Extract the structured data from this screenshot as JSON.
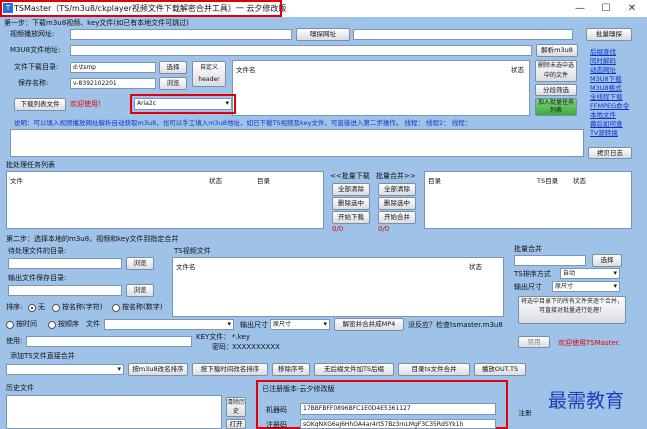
{
  "window": {
    "title": "TSMaster（TS/m3u8/ckplayer视频文件下载解密合并工具）一 云夕修改版",
    "minimize": "—",
    "maximize": "☐",
    "close": "✕"
  },
  "step1": {
    "label": "第一步：下载m3u8视频、key文件(如已有本地文件可跳过)"
  },
  "video_url": {
    "label": "视频播放网址:",
    "value": "",
    "clean_btn": "嗅探网址",
    "batch_btn": "批量嗅探"
  },
  "m3u8_url": {
    "label": "M3U8文件地址:",
    "value": "",
    "parse_btn": "解析m3u8"
  },
  "download_dir": {
    "label": "文件下载目录:",
    "value": "d:\\tsmp",
    "select_btn": "选择",
    "custom_btn": "自定义header"
  },
  "save_name": {
    "label": "保存名称:",
    "value": "v-8392102201",
    "browse_btn": "浏览"
  },
  "file_list": {
    "col_name": "文件名",
    "col_status": "状态"
  },
  "side_buttons": {
    "delete_unselected": "删除未选中选中的文件",
    "segment_filter": "分段筛选",
    "add_to_queue": "加入批量任务列表"
  },
  "download_row": {
    "btn": "下载列表文件",
    "welcome": "欢迎使用！",
    "engine": "Aria2c"
  },
  "links": [
    "后缀查找",
    "同时解码",
    "动态网址",
    "M3U8下载",
    "M3U8格式",
    "全线程下载",
    "FFMPEG命令",
    "本地文件",
    "幕后如何查",
    "TV源转换"
  ],
  "note": {
    "text": "说明：可以填入视频播放网址解析自动获取m3u8，也可以手工填入m3u8地址，如已下载TS视频及key文件，可直接进入第二步操作。 线程：  线程2：  线程："
  },
  "view_log": "拷贝日志",
  "batch": {
    "title": "批处理任务列表",
    "col_file": "文件",
    "col_status": "状态",
    "col_dir": "目录",
    "download_label": "<<批量下载",
    "start_all": "全部清除",
    "delete_selected": "删除选中",
    "start_download": "开始下载",
    "count1": "0/0",
    "merge_label": "批量合并>>",
    "merge_all": "全部清除",
    "merge_delete": "删除选中",
    "start_merge": "开始合并",
    "count2": "0/0",
    "col_dir2": "目录",
    "col_ts": "TS目录",
    "col_status2": "状态"
  },
  "step2": {
    "label": "第二步：选择本地的m3u8，视频和key文件到指定合并"
  },
  "pending": {
    "label": "待处理文件的目录:",
    "value": "",
    "browse_btn": "浏览"
  },
  "output_dir": {
    "label": "输出文件保存目录:",
    "value": "",
    "browse_btn": "浏览"
  },
  "ts_list": {
    "title": "TS视频文件",
    "col_name": "文件名",
    "col_status": "状态"
  },
  "sort": {
    "label": "排序:",
    "opt_none": "无",
    "opt_name_char": "按名称(字符)",
    "opt_name_num": "按名称(数字)"
  },
  "by_time": {
    "opt_time": "按时间",
    "opt_order": "按顺序",
    "file_label": "文件"
  },
  "key_info": {
    "key_label": "KEY文件：",
    "key_value": "*.key",
    "pass_label": "密码：",
    "pass_value": "XXXXXXXXXX"
  },
  "output_size": {
    "label": "输出尺寸",
    "value": "原尺寸",
    "decrypt_btn": "解密并合并成MP4",
    "hint": "没反应？检查tsmaster.m3u8"
  },
  "use": {
    "label": "使用:",
    "value": ""
  },
  "merge_panel": {
    "title": "批量合并",
    "select_btn": "选择",
    "ts_sort_label": "TS排序方式",
    "ts_sort_value": "自动",
    "out_size_label": "输出尺寸",
    "out_size_value": "原尺寸",
    "merge_btn": "将选中目录下的所有文件夹逐个合并，可直接对批量进行处理！"
  },
  "bottom_right": {
    "disable_btn": "禁用",
    "welcome": "欢迎使用TSMaster."
  },
  "add_ts": {
    "label": "添加TS文件直接合并",
    "btn1": "按m3u8改名排序",
    "btn2": "按下载时间改名排序",
    "btn3": "移除序号",
    "btn4": "无后缀文件加TS后缀",
    "btn5": "目录ts文件合并",
    "btn6": "播放OUT.TS"
  },
  "history": {
    "label": "历史文件",
    "clear_btn": "清除历史",
    "open_btn": "打开"
  },
  "register": {
    "title": "已注册版本-云夕修改版",
    "machine_label": "机器码",
    "machine_value": "17BBFBFF0896BFC1E0D4E5361127",
    "code_label": "注册码",
    "code_value": "sOKqNXG6aJ6HhOA4ar4rt57Bz3rnLMgF3C35RdSYk1h",
    "register_btn": "注册"
  },
  "watermark": "最需教育"
}
